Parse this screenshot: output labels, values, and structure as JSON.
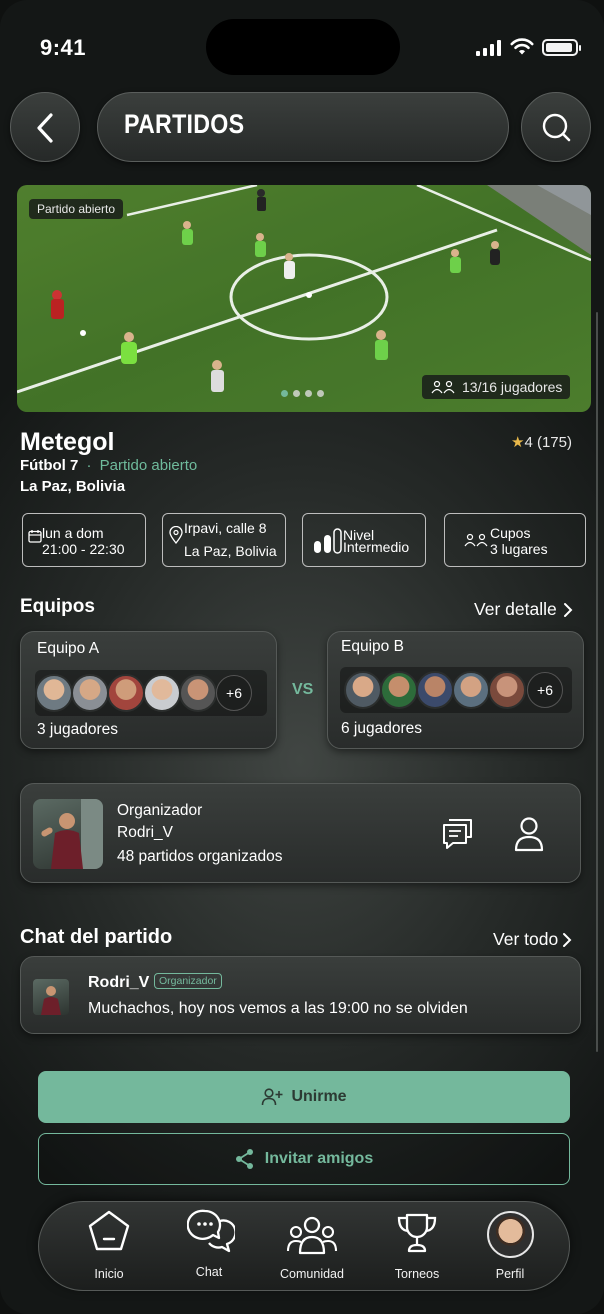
{
  "status_bar": {
    "time": "9:41"
  },
  "header": {
    "title": "PARTIDOS"
  },
  "hero": {
    "badge": "Partido abierto",
    "players_count": "13/16 jugadores",
    "carousel_pages": 4,
    "carousel_active": 0
  },
  "match": {
    "name": "Metegol",
    "rating": "4 (175)",
    "type": "Fútbol 7",
    "separator": "·",
    "status": "Partido abierto",
    "location": "La Paz, Bolivia"
  },
  "chips": {
    "schedule": {
      "line1": "lun a dom",
      "line2": "21:00 - 22:30",
      "icon": "calendar-icon"
    },
    "address": {
      "line1": "Irpavi, calle 8",
      "line2": "La Paz, Bolivia",
      "icon": "location-pin-icon"
    },
    "level": {
      "line1": "Nivel",
      "line2": "Intermedio",
      "icon": "level-bars-icon"
    },
    "slots": {
      "line1": "Cupos",
      "line2": "3 lugares",
      "icon": "players-icon"
    }
  },
  "teams": {
    "section_title": "Equipos",
    "detail_link": "Ver detalle",
    "vs": "VS",
    "team_a": {
      "name": "Equipo A",
      "more": "+6",
      "count": "3 jugadores"
    },
    "team_b": {
      "name": "Equipo B",
      "more": "+6",
      "count": "6 jugadores"
    }
  },
  "organizer": {
    "label": "Organizador",
    "name": "Rodri_V",
    "stats": "48 partidos organizados"
  },
  "chat": {
    "section_title": "Chat del partido",
    "see_all": "Ver todo",
    "author": "Rodri_V",
    "role_badge": "Organizador",
    "message": "Muchachos, hoy nos vemos a las 19:00 no se olviden"
  },
  "actions": {
    "join": "Unirme",
    "invite": "Invitar amigos"
  },
  "nav": {
    "items": [
      {
        "label": "Inicio",
        "icon": "home-pentagon-icon"
      },
      {
        "label": "Chat",
        "icon": "chat-bubbles-icon"
      },
      {
        "label": "Comunidad",
        "icon": "community-icon"
      },
      {
        "label": "Torneos",
        "icon": "trophy-icon"
      },
      {
        "label": "Perfil",
        "icon": "profile-avatar"
      }
    ]
  },
  "colors": {
    "accent": "#74b89c",
    "background": "#262a28"
  }
}
